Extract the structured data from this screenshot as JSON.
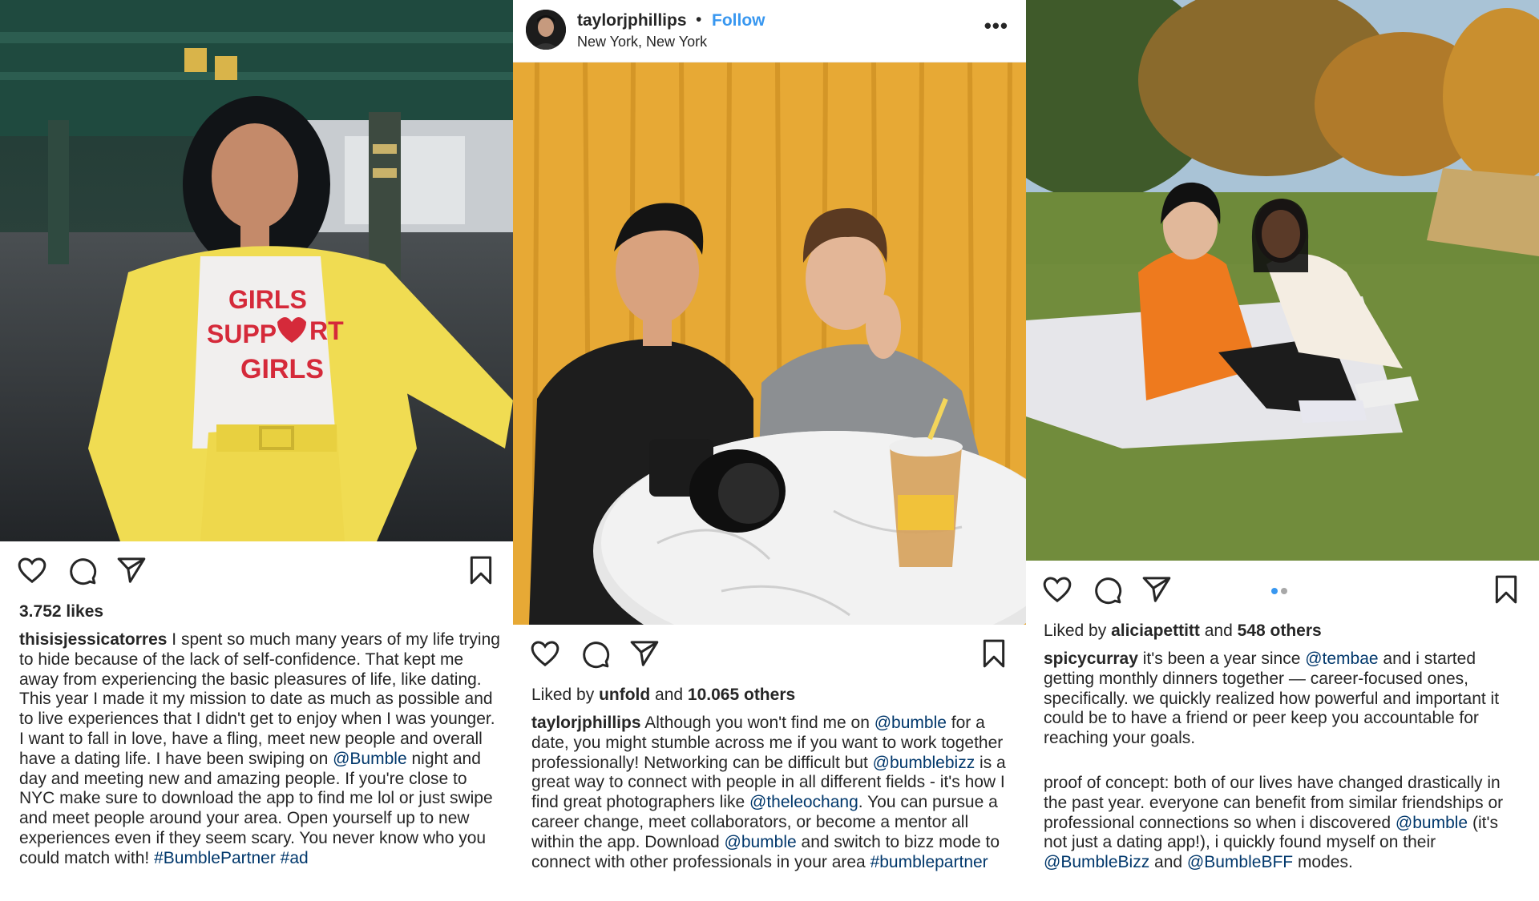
{
  "posts": [
    {
      "likes_text": "3.752 likes",
      "caption": {
        "username": "thisisjessicatorres",
        "text1": " I spent so much many years of my life trying to hide because of the lack of self-confidence. That kept me away from experiencing the basic pleasures of life, like dating. This year I made it my mission to date as much as possible and to live experiences that I didn't get to enjoy when I was younger. I want to fall in love, have a fling, meet new people and overall have a dating life. I have been swiping on ",
        "mention1": "@Bumble",
        "text2": " night and day and meeting new and amazing people. If you're close to NYC make sure to download the app to find me lol or just swipe and meet people around your area. Open yourself up to new experiences even if they seem scary. You never know who you could match with!  ",
        "hashtag1": "#BumblePartner",
        "text3": " ",
        "hashtag2": "#ad"
      },
      "shirt_text": [
        "GIRLS",
        "SUPP",
        "RT",
        "GIRLS"
      ]
    },
    {
      "header": {
        "username": "taylorjphillips",
        "separator": "•",
        "follow": "Follow",
        "location": "New York, New York",
        "more": "•••"
      },
      "liked_by": {
        "prefix": "Liked by ",
        "user": "unfold",
        "middle": " and ",
        "others": "10.065 others"
      },
      "caption": {
        "username": "taylorjphillips",
        "text1": " Although you won't find me on ",
        "mention1": "@bumble",
        "text2": " for a date, you might stumble across me if you want to work together professionally! Networking can be difficult but ",
        "mention2": "@bumblebizz",
        "text3": " is a great way to connect with people in all different fields - it's how I find great photographers like ",
        "mention3": "@theleochang",
        "text4": ". You can pursue a career change, meet collaborators, or become a mentor all within the app. Download ",
        "mention4": "@bumble",
        "text5": " and switch to bizz mode to connect with other professionals in your area ",
        "hashtag1": "#bumblepartner"
      }
    },
    {
      "liked_by": {
        "prefix": "Liked by ",
        "user": "aliciapettitt",
        "middle": " and ",
        "others": "548 others"
      },
      "caption": {
        "username": "spicycurray",
        "text1": " it's been a year since ",
        "mention1": "@tembae",
        "text2": " and i started getting monthly dinners together — career-focused ones, specifically. we quickly realized how powerful and important it could be to have a friend or peer keep you accountable for reaching your goals.",
        "text3": "proof of concept: both of our lives have changed drastically in the past year. everyone can benefit from similar friendships or professional connections so when i discovered ",
        "mention2": "@bumble",
        "text4": " (it's not just a dating app!), i quickly found myself on their ",
        "mention3": "@BumbleBizz",
        "text5": " and ",
        "mention4": "@BumbleBFF",
        "text6": " modes."
      },
      "carousel": {
        "count": 2,
        "active": 0,
        "active_color": "#3897f0",
        "inactive_color": "#a8a8a8"
      }
    }
  ],
  "icons": [
    "heart-icon",
    "comment-icon",
    "share-icon",
    "bookmark-icon"
  ],
  "colors": {
    "link": "#00376b",
    "follow": "#3897f0",
    "text": "#262626"
  }
}
